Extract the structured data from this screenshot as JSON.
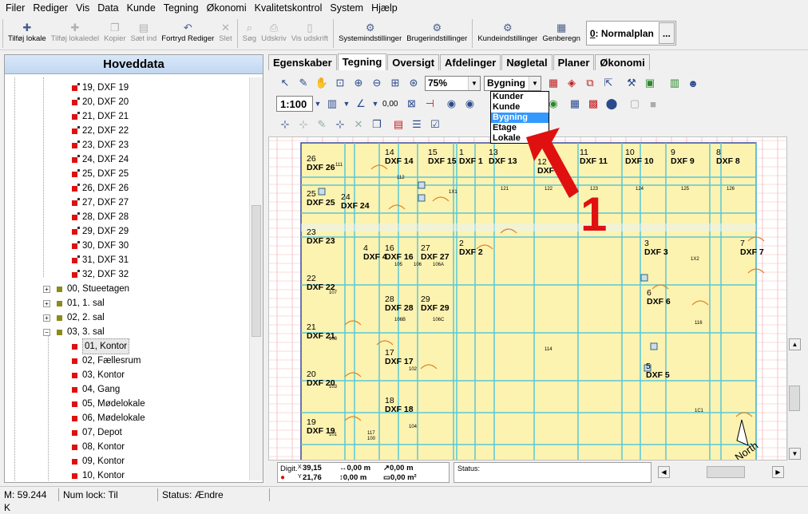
{
  "menu": [
    "Filer",
    "Rediger",
    "Vis",
    "Data",
    "Kunde",
    "Tegning",
    "Økonomi",
    "Kvalitetskontrol",
    "System",
    "Hjælp"
  ],
  "toolbar": {
    "buttons": [
      {
        "label": "Tilføj lokale",
        "icon": "add-room-icon",
        "disabled": false
      },
      {
        "label": "Tilføj lokaledel",
        "icon": "add-room-part-icon",
        "disabled": true
      },
      {
        "label": "Kopier",
        "icon": "copy-icon",
        "disabled": true
      },
      {
        "label": "Sæt ind",
        "icon": "paste-icon",
        "disabled": true
      },
      {
        "label": "Fortryd Rediger",
        "icon": "undo-icon",
        "disabled": false
      },
      {
        "label": "Slet",
        "icon": "delete-icon",
        "disabled": true
      },
      {
        "label": "Søg",
        "icon": "search-icon",
        "disabled": true
      },
      {
        "label": "Udskriv",
        "icon": "print-icon",
        "disabled": true
      },
      {
        "label": "Vis udskrift",
        "icon": "print-preview-icon",
        "disabled": true
      },
      {
        "label": "Systemindstillinger",
        "icon": "system-settings-icon",
        "disabled": false
      },
      {
        "label": "Brugerindstillinger",
        "icon": "user-settings-icon",
        "disabled": false
      },
      {
        "label": "Kundeindstillinger",
        "icon": "customer-settings-icon",
        "disabled": false
      },
      {
        "label": "Genberegn",
        "icon": "recalculate-icon",
        "disabled": false
      }
    ],
    "plan_prefix": "0",
    "plan_rest": ": Normalplan",
    "plan_more": "..."
  },
  "left_panel": {
    "title": "Hoveddata",
    "dxf_items": [
      "19, DXF 19",
      "20, DXF 20",
      "21, DXF 21",
      "22, DXF 22",
      "23, DXF 23",
      "24, DXF 24",
      "25, DXF 25",
      "26, DXF 26",
      "27, DXF 27",
      "28, DXF 28",
      "29, DXF 29",
      "30, DXF 30",
      "31, DXF 31",
      "32, DXF 32"
    ],
    "floors": [
      "00, Stueetagen",
      "01, 1. sal",
      "02, 2. sal",
      "03, 3. sal"
    ],
    "rooms": [
      "01, Kontor",
      "02, Fællesrum",
      "03, Kontor",
      "04, Gang",
      "05, Mødelokale",
      "06, Mødelokale",
      "07, Depot",
      "08, Kontor",
      "09, Kontor",
      "10, Kontor"
    ]
  },
  "tabs": [
    "Egenskaber",
    "Tegning",
    "Oversigt",
    "Afdelinger",
    "Nøgletal",
    "Planer",
    "Økonomi"
  ],
  "active_tab": "Tegning",
  "drawing": {
    "zoom": "75%",
    "level_select": "Bygning",
    "level_options": [
      "Kunder",
      "Kunde",
      "Bygning",
      "Etage",
      "Lokale"
    ],
    "scale": "1:100",
    "offset_value": "0,00"
  },
  "plan_labels": [
    {
      "num": "26",
      "name": "DXF 26"
    },
    {
      "num": "14",
      "name": "DXF 14"
    },
    {
      "num": "15",
      "name": "DXF 15"
    },
    {
      "num": "1",
      "name": "DXF 1"
    },
    {
      "num": "13",
      "name": "DXF 13"
    },
    {
      "num": "12",
      "name": "DXF 12"
    },
    {
      "num": "11",
      "name": "DXF 11"
    },
    {
      "num": "10",
      "name": "DXF 10"
    },
    {
      "num": "9",
      "name": "DXF 9"
    },
    {
      "num": "8",
      "name": "DXF 8"
    },
    {
      "num": "25",
      "name": "DXF 25"
    },
    {
      "num": "24",
      "name": "DXF 24"
    },
    {
      "num": "23",
      "name": "DXF 23"
    },
    {
      "num": "4",
      "name": "DXF 4"
    },
    {
      "num": "16",
      "name": "DXF 16"
    },
    {
      "num": "27",
      "name": "DXF 27"
    },
    {
      "num": "2",
      "name": "DXF 2"
    },
    {
      "num": "3",
      "name": "DXF 3"
    },
    {
      "num": "7",
      "name": "DXF 7"
    },
    {
      "num": "22",
      "name": "DXF 22"
    },
    {
      "num": "6",
      "name": "DXF 6"
    },
    {
      "num": "28",
      "name": "DXF 28"
    },
    {
      "num": "29",
      "name": "DXF 29"
    },
    {
      "num": "21",
      "name": "DXF 21"
    },
    {
      "num": "17",
      "name": "DXF 17"
    },
    {
      "num": "5",
      "name": "DXF 5"
    },
    {
      "num": "20",
      "name": "DXF 20"
    },
    {
      "num": "18",
      "name": "DXF 18"
    },
    {
      "num": "19",
      "name": "DXF 19"
    }
  ],
  "plan_small": [
    "111",
    "112",
    "1X1",
    "121",
    "122",
    "123",
    "124",
    "125",
    "126",
    "1X2",
    "105",
    "106",
    "106A",
    "107",
    "108",
    "106B",
    "106C",
    "114",
    "116",
    "103",
    "102",
    "104",
    "101",
    "100",
    "1C1",
    "117"
  ],
  "north": "North",
  "annotation": "1",
  "coords": {
    "label": "Digit.",
    "x_label": "X",
    "x": "39,15",
    "y_label": "Y",
    "y": "21,76",
    "dx": "0,00 m",
    "dy": "0,00 m",
    "len": "0,00 m",
    "area": "0,00 m²"
  },
  "coord_status": "Status:",
  "statusbar": {
    "memory": "M: 59.244 K",
    "numlock": "Num lock: Til",
    "status": "Status: Ændre"
  }
}
